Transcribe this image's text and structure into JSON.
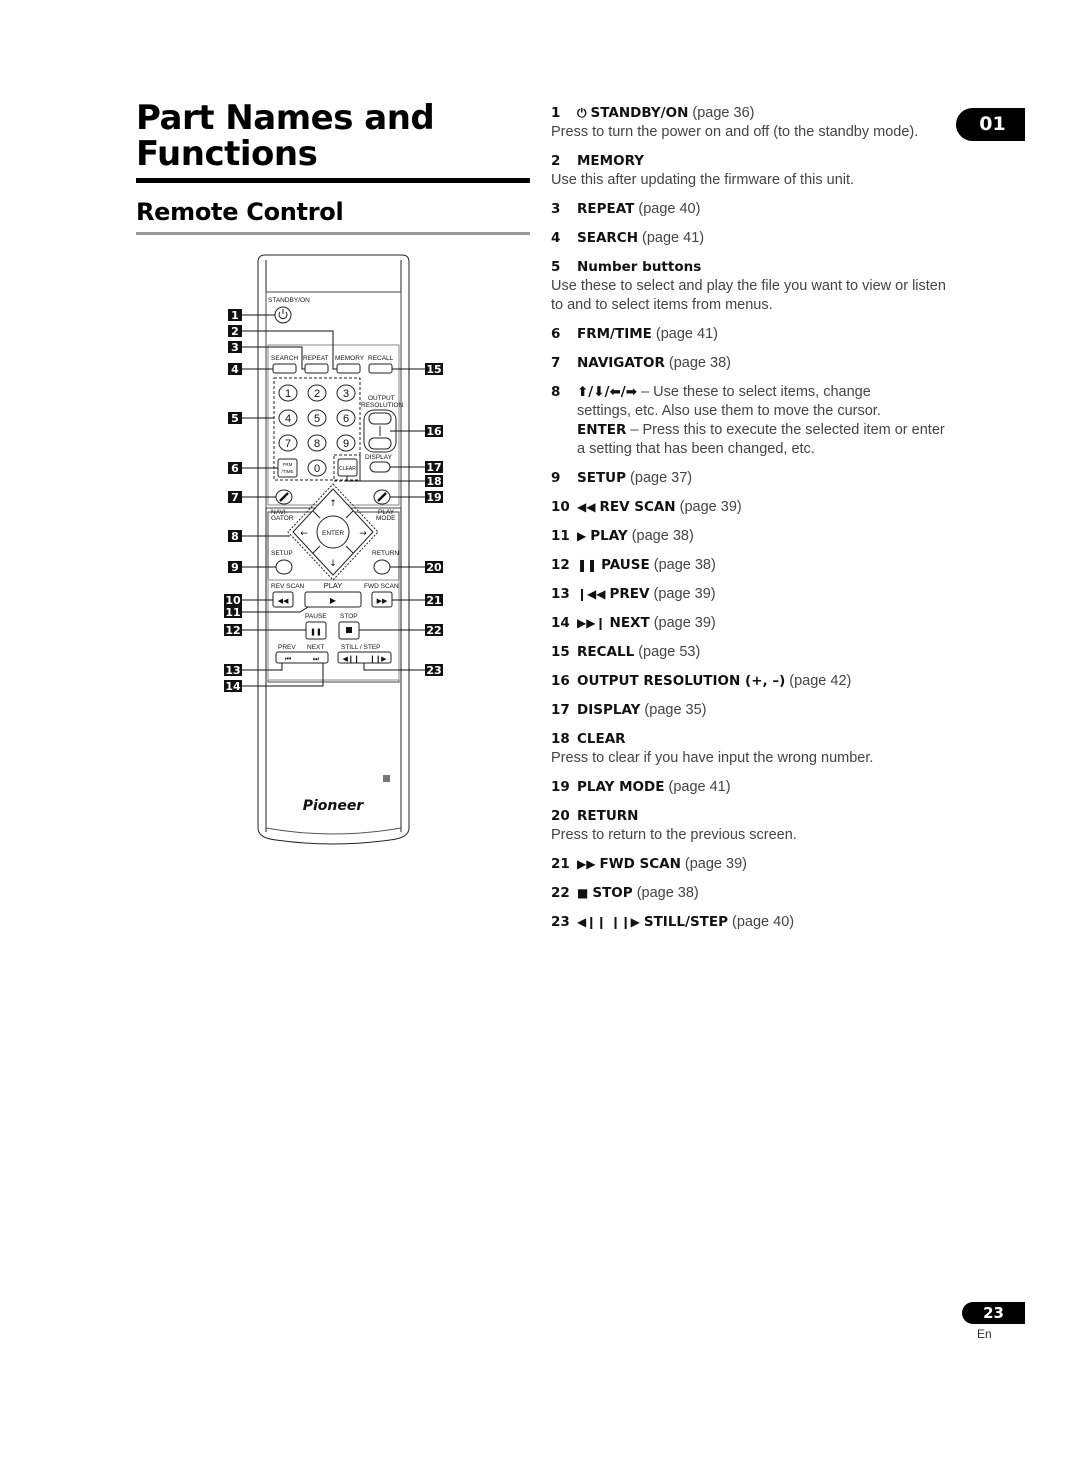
{
  "header": {
    "title_line1": "Part Names and",
    "title_line2": "Functions",
    "section": "Remote Control",
    "chapter": "01"
  },
  "footer": {
    "page_number": "23",
    "language": "En"
  },
  "remote": {
    "labels": {
      "standby": "STANDBY/ON",
      "search": "SEARCH",
      "repeat": "REPEAT",
      "memory": "MEMORY",
      "recall": "RECALL",
      "output": "OUTPUT",
      "resolution": "RESOLUTION",
      "display": "DISPLAY",
      "frm": "FRM",
      "time": "/TIME",
      "clear": "CLEAR",
      "navi": "NAVI-",
      "gator": "GATOR",
      "play": "PLAY",
      "mode": "MODE",
      "enter": "ENTER",
      "setup": "SETUP",
      "return": "RETURN",
      "rev_scan": "REV SCAN",
      "play_label": "PLAY",
      "fwd_scan": "FWD SCAN",
      "pause": "PAUSE",
      "stop": "STOP",
      "prev": "PREV",
      "next": "NEXT",
      "still_step": "STILL / STEP",
      "brand": "Pioneer",
      "plus": "+",
      "minus": "–"
    },
    "digits": [
      "1",
      "2",
      "3",
      "4",
      "5",
      "6",
      "7",
      "8",
      "9",
      "0"
    ],
    "callouts": [
      "1",
      "2",
      "3",
      "4",
      "5",
      "6",
      "7",
      "8",
      "9",
      "10",
      "11",
      "12",
      "13",
      "14",
      "15",
      "16",
      "17",
      "18",
      "19",
      "20",
      "21",
      "22",
      "23"
    ]
  },
  "items": [
    {
      "num": "1",
      "symbol": "⏻",
      "name": "STANDBY/ON",
      "ref": "(page 36)",
      "desc": "Press to turn the power on and off (to the standby mode)."
    },
    {
      "num": "2",
      "name": "MEMORY",
      "desc": "Use this after updating the firmware of this unit."
    },
    {
      "num": "3",
      "name": "REPEAT",
      "ref": "(page 40)"
    },
    {
      "num": "4",
      "name": "SEARCH",
      "ref": "(page 41)"
    },
    {
      "num": "5",
      "name": "Number buttons",
      "desc": "Use these to select and play the file you want to view or listen to and to select items from menus."
    },
    {
      "num": "6",
      "name": "FRM/TIME",
      "ref": "(page 41)"
    },
    {
      "num": "7",
      "name": "NAVIGATOR",
      "ref": "(page 38)"
    },
    {
      "num": "8",
      "name": "⬆/⬇/⬅/➡",
      "desc_head": "– Use these to select items, change",
      "desc": "settings, etc. Also use them to move the cursor.",
      "desc2_bold": "ENTER",
      "desc2": "– Press this to execute the selected item or enter a setting that has been changed, etc."
    },
    {
      "num": "9",
      "name": "SETUP",
      "ref": "(page 37)"
    },
    {
      "num": "10",
      "symbol": "◀◀",
      "name": "REV SCAN",
      "ref": "(page 39)"
    },
    {
      "num": "11",
      "symbol": "▶",
      "name": "PLAY",
      "ref": "(page 38)"
    },
    {
      "num": "12",
      "symbol": "❚❚",
      "name": "PAUSE",
      "ref": "(page 38)"
    },
    {
      "num": "13",
      "symbol": "❙◀◀",
      "name": "PREV",
      "ref": "(page 39)"
    },
    {
      "num": "14",
      "symbol": "▶▶❙",
      "name": "NEXT",
      "ref": "(page 39)"
    },
    {
      "num": "15",
      "name": "RECALL",
      "ref": "(page 53)"
    },
    {
      "num": "16",
      "name": "OUTPUT RESOLUTION (+, –)",
      "ref": "(page 42)"
    },
    {
      "num": "17",
      "name": "DISPLAY",
      "ref": "(page 35)"
    },
    {
      "num": "18",
      "name": "CLEAR",
      "desc": "Press to clear if you have input the wrong number."
    },
    {
      "num": "19",
      "name": "PLAY MODE",
      "ref": "(page 41)"
    },
    {
      "num": "20",
      "name": "RETURN",
      "desc": "Press to return to the previous screen."
    },
    {
      "num": "21",
      "symbol": "▶▶",
      "name": "FWD SCAN",
      "ref": "(page 39)"
    },
    {
      "num": "22",
      "symbol": "■",
      "name": "STOP",
      "ref": "(page 38)"
    },
    {
      "num": "23",
      "symbol": "◀❙❙ ❙❙▶",
      "name": "STILL/STEP",
      "ref": "(page 40)"
    }
  ]
}
